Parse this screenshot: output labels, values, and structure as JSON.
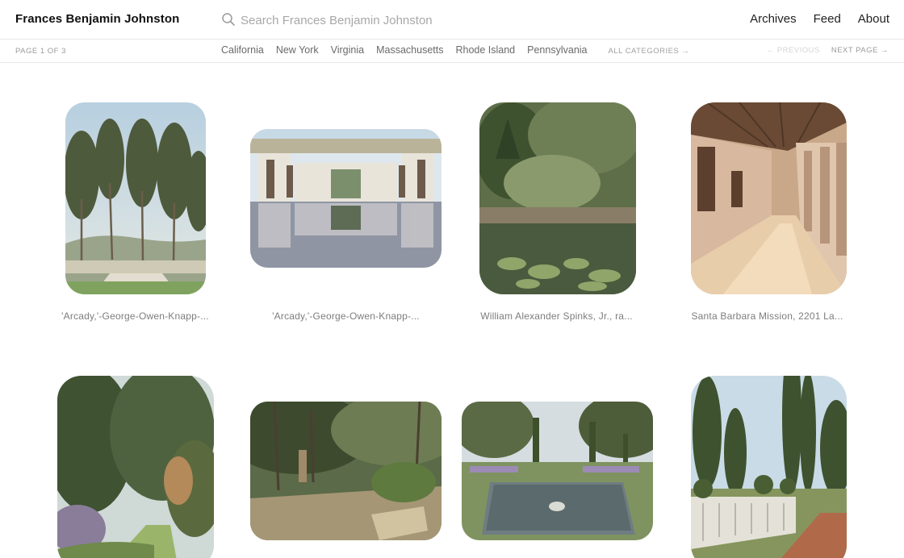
{
  "header": {
    "title": "Frances Benjamin Johnston",
    "search_placeholder": "Search Frances Benjamin Johnston",
    "search_icon": "search-icon",
    "nav": [
      "Archives",
      "Feed",
      "About"
    ]
  },
  "subbar": {
    "page_count": "PAGE 1 OF 3",
    "categories": [
      "California",
      "New York",
      "Virginia",
      "Massachusetts",
      "Rhode Island",
      "Pennsylvania"
    ],
    "all_categories": "ALL CATEGORIES →",
    "previous": "← PREVIOUS",
    "next": "NEXT PAGE →"
  },
  "grid": {
    "items": [
      {
        "caption": "'Arcady,'-George-Owen-Knapp-...",
        "photo": "eucalyptus-terrace-photo"
      },
      {
        "caption": "'Arcady,'-George-Owen-Knapp-...",
        "photo": "reflecting-pool-colonnade-photo"
      },
      {
        "caption": "William Alexander Spinks, Jr., ra...",
        "photo": "lily-pond-garden-photo"
      },
      {
        "caption": "Santa Barbara Mission, 2201 La...",
        "photo": "mission-arcade-photo"
      },
      {
        "caption": "",
        "photo": "cypress-garden-path-photo"
      },
      {
        "caption": "",
        "photo": "wooded-garden-steps-photo"
      },
      {
        "caption": "",
        "photo": "formal-garden-pool-photo"
      },
      {
        "caption": "",
        "photo": "balustrade-terrace-photo"
      }
    ]
  }
}
